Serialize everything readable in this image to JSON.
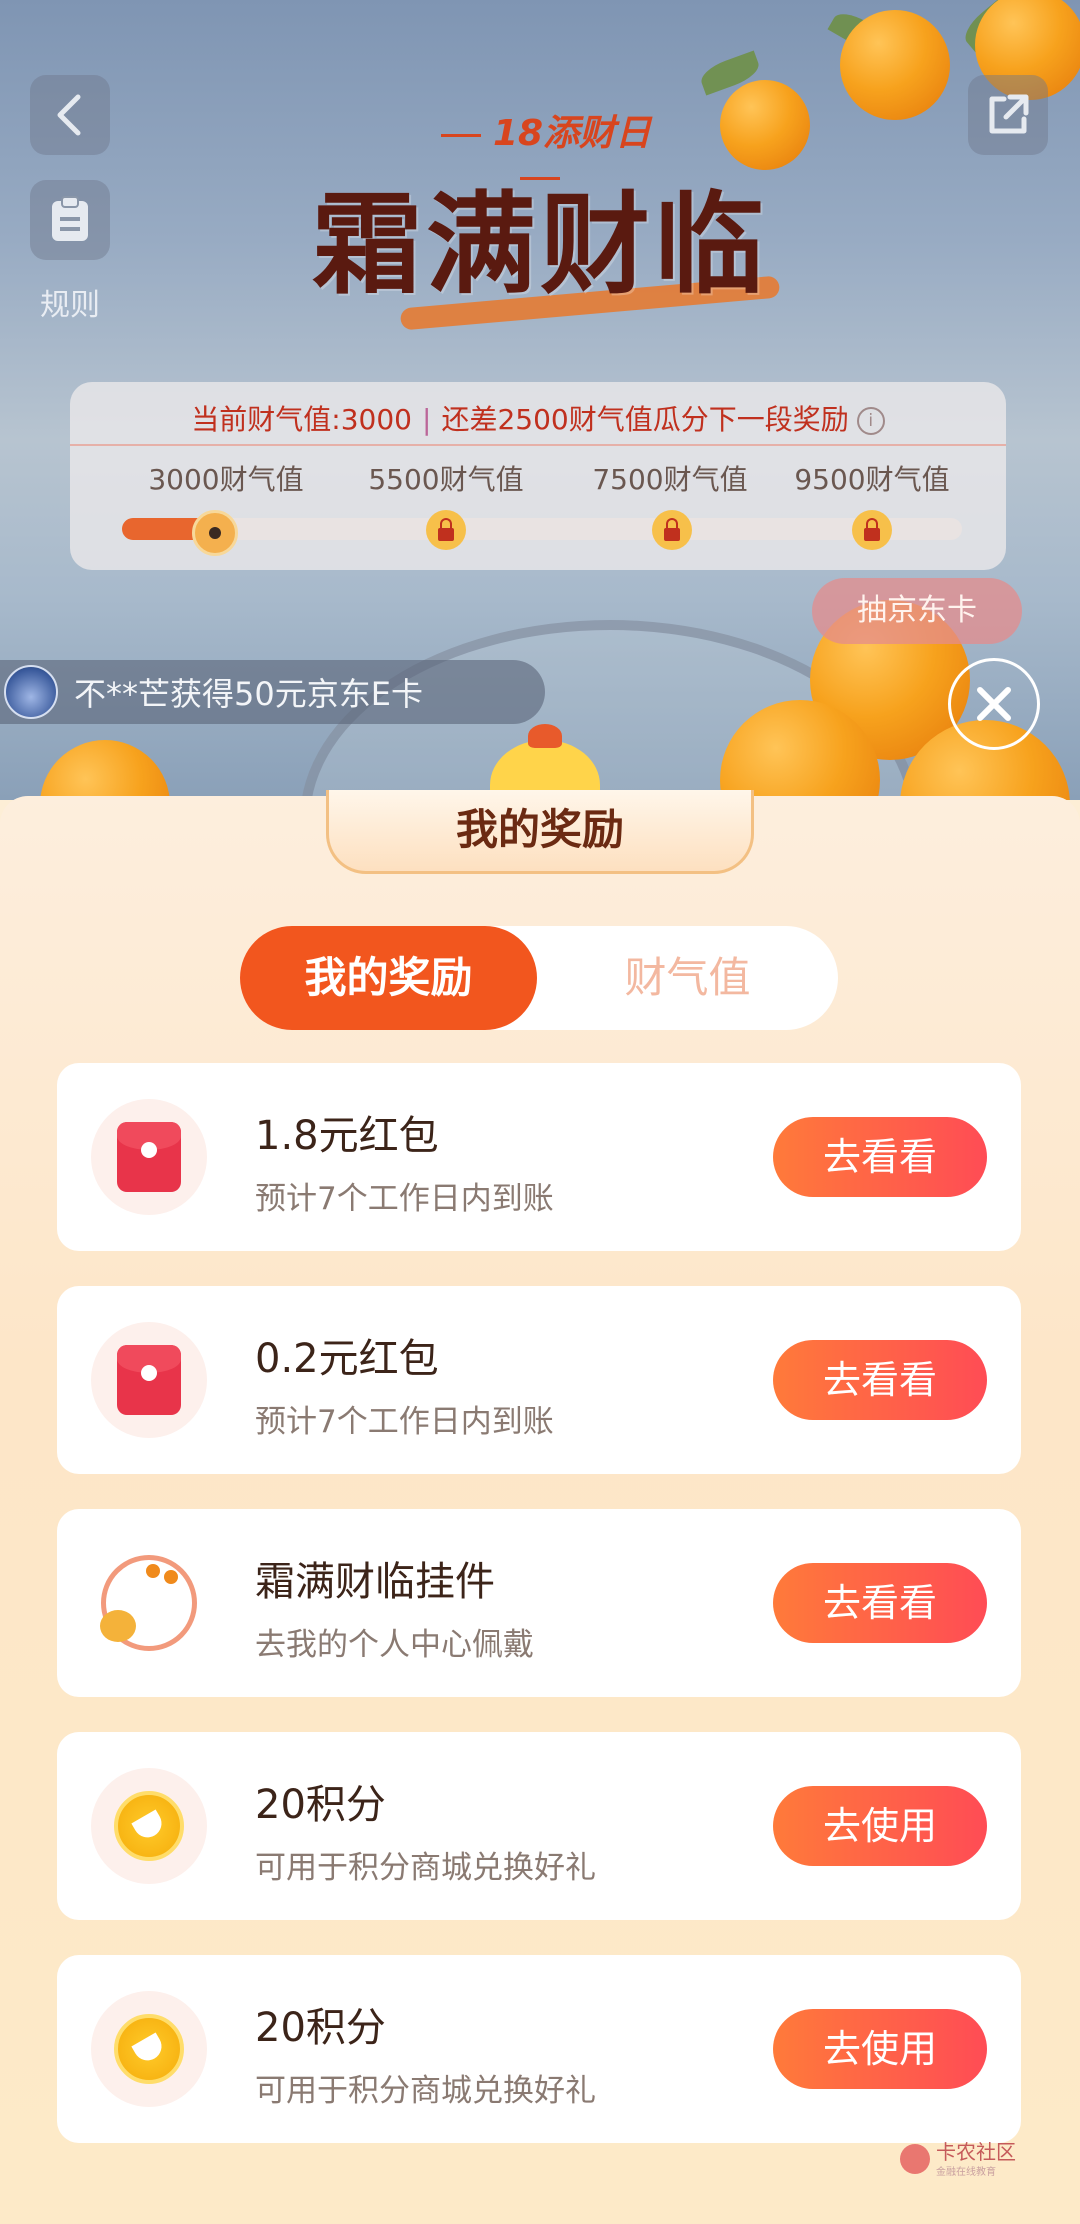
{
  "header": {
    "back_icon": "chevron-left-icon",
    "share_icon": "share-icon",
    "rules_icon": "document-icon",
    "rules_label": "规则"
  },
  "event": {
    "tag": "18添财日",
    "title": "霜满财临"
  },
  "progress": {
    "status_current": "当前财气值:3000",
    "status_remaining": "还差2500财气值瓜分下一段奖励",
    "milestones": [
      {
        "label": "3000财气值",
        "state": "current"
      },
      {
        "label": "5500财气值",
        "state": "locked"
      },
      {
        "label": "7500财气值",
        "state": "locked"
      },
      {
        "label": "9500财气值",
        "state": "locked"
      }
    ],
    "fill_fraction": 0.12
  },
  "draw_card_label": "抽京东卡",
  "ticker_text": "不**芒获得50元京东E卡",
  "sheet": {
    "title": "我的奖励",
    "tabs": [
      {
        "label": "我的奖励",
        "active": true
      },
      {
        "label": "财气值",
        "active": false
      }
    ]
  },
  "rewards": [
    {
      "icon": "red-envelope-icon",
      "title": "1.8元红包",
      "subtitle": "预计7个工作日内到账",
      "button": "去看看"
    },
    {
      "icon": "red-envelope-icon",
      "title": "0.2元红包",
      "subtitle": "预计7个工作日内到账",
      "button": "去看看"
    },
    {
      "icon": "pendant-frame-icon",
      "title": "霜满财临挂件",
      "subtitle": "去我的个人中心佩戴",
      "button": "去看看"
    },
    {
      "icon": "points-coin-icon",
      "title": "20积分",
      "subtitle": "可用于积分商城兑换好礼",
      "button": "去使用"
    },
    {
      "icon": "points-coin-icon",
      "title": "20积分",
      "subtitle": "可用于积分商城兑换好礼",
      "button": "去使用"
    }
  ],
  "watermark": {
    "name": "卡农社区",
    "tagline": "金融在线教育"
  },
  "colors": {
    "accent": "#f2561e",
    "button_gradient_start": "#ff7a3a",
    "button_gradient_end": "#ff4c55",
    "status_red": "#c0301e"
  }
}
